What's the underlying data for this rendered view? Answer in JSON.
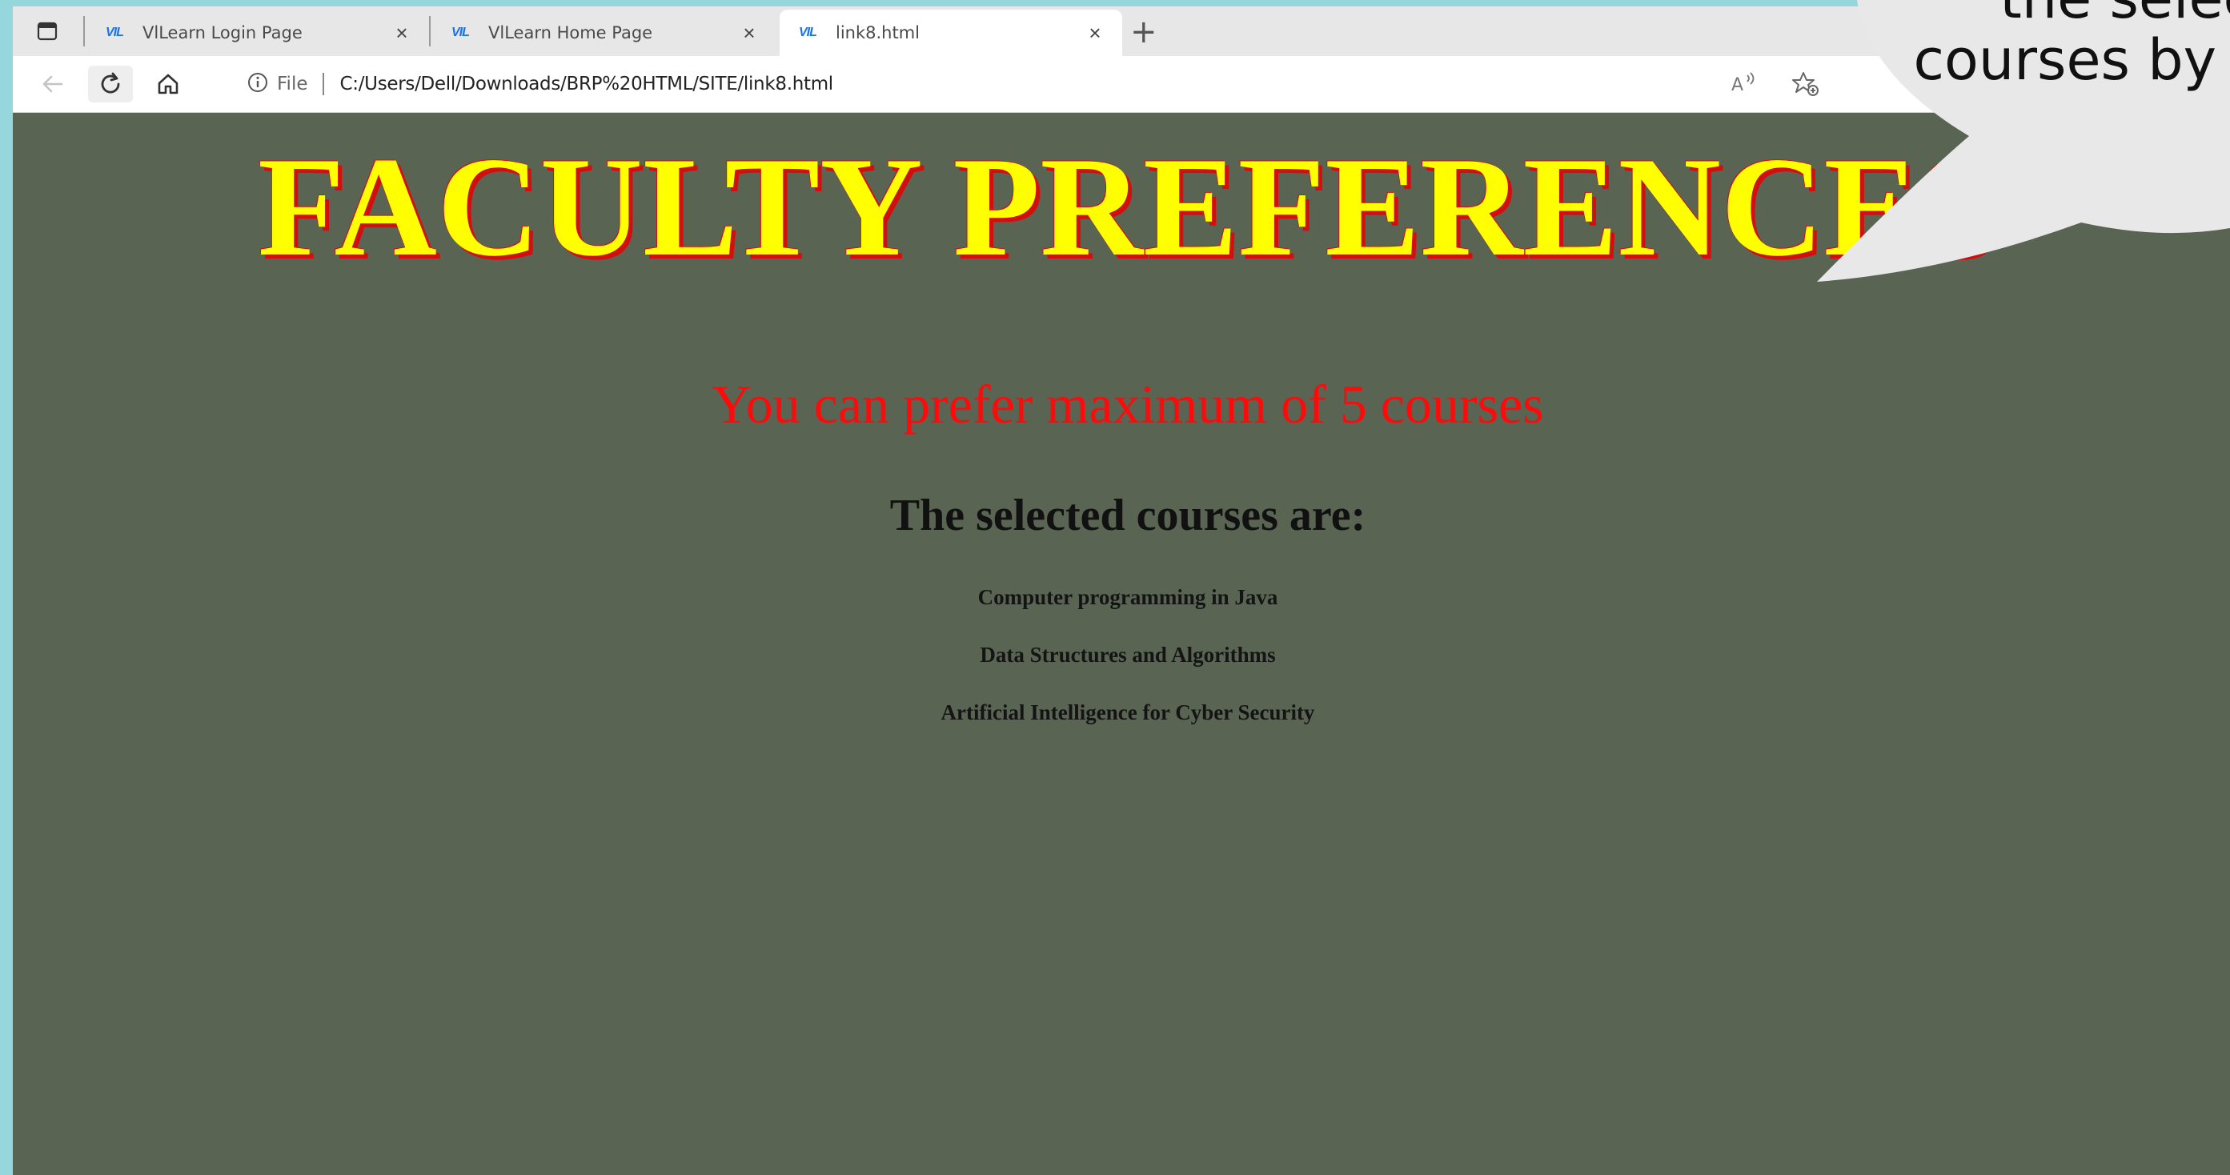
{
  "browser": {
    "tabs": [
      {
        "favicon": "VIL",
        "title": "VlLearn Login Page",
        "active": false
      },
      {
        "favicon": "VIL",
        "title": "VlLearn Home Page",
        "active": false
      },
      {
        "favicon": "VIL",
        "title": "link8.html",
        "active": true
      }
    ],
    "close_glyph": "×",
    "newtab_glyph": "+",
    "address": {
      "scheme_label": "File",
      "url": "C:/Users/Dell/Downloads/BRP%20HTML/SITE/link8.html"
    },
    "icons": [
      "tab-actions-icon",
      "back-icon",
      "refresh-icon",
      "home-icon",
      "info-icon",
      "read-aloud-icon",
      "favorite-icon"
    ]
  },
  "page": {
    "title": "FACULTY PREFERENCES",
    "notice": "You can prefer maximum of 5 courses",
    "heading": "The selected courses are:",
    "courses": [
      "Computer programming in Java",
      "Data Structures and Algorithms",
      "Artificial Intelligence for Cyber Security"
    ]
  },
  "overlay": {
    "bubble_lines": [
      "the selec",
      "courses by f"
    ]
  },
  "colors": {
    "page_background": "#5a6453",
    "title_fill": "#ffff00",
    "title_shadow": "#d20f0f",
    "notice": "#ff0a0a",
    "outer_background": "#95d7dc",
    "bubble": "#e8e8e8"
  }
}
